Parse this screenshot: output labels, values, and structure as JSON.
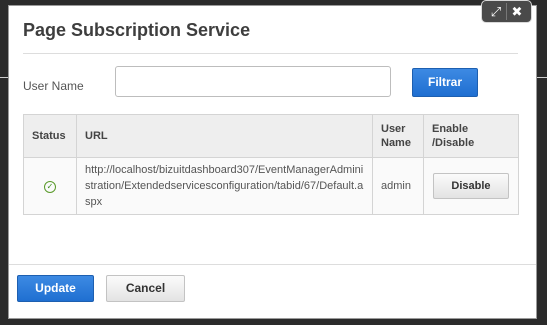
{
  "modal": {
    "title": "Page Subscription Service",
    "controls": {
      "expand_icon": "expand-icon",
      "close_icon": "close-icon"
    }
  },
  "filter": {
    "user_label": "User Name",
    "user_value": "",
    "filter_label": "Filtrar"
  },
  "table": {
    "headers": {
      "status": "Status",
      "url": "URL",
      "user": "User Name",
      "action": "Enable /Disable"
    },
    "rows": [
      {
        "status_icon": "check-circle-icon",
        "url": "http://localhost/bizuitdashboard307/EventManagerAdministration/Extendedservicesconfiguration/tabid/67/Default.aspx",
        "user": "admin",
        "action_label": "Disable"
      }
    ]
  },
  "footer": {
    "update_label": "Update",
    "cancel_label": "Cancel"
  },
  "colors": {
    "primary": "#1f6fd1",
    "status_ok": "#3a8a1a"
  }
}
